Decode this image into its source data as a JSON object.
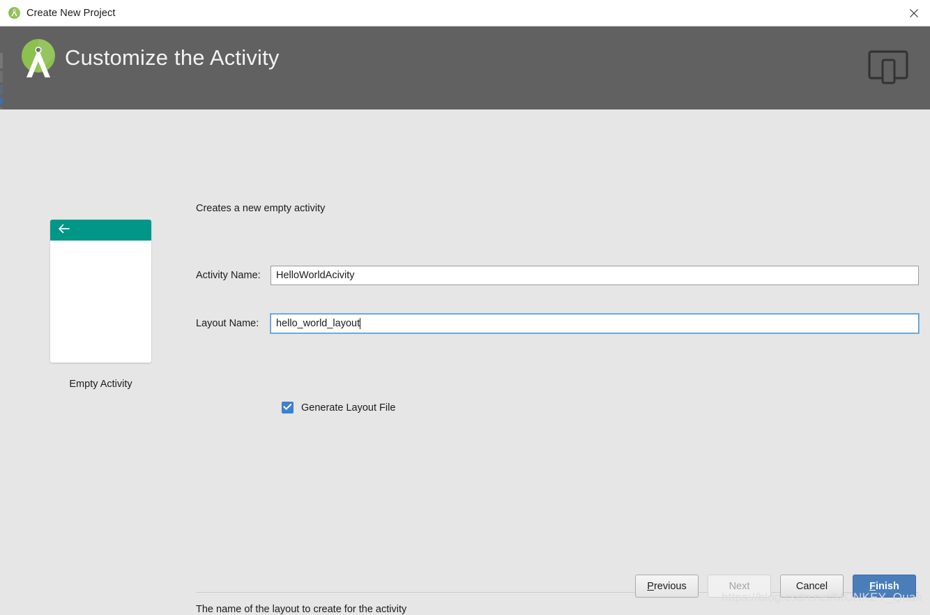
{
  "titlebar": {
    "title": "Create New Project",
    "logo_icon": "android-studio-logo-icon",
    "close_icon": "close-icon"
  },
  "header": {
    "title": "Customize the Activity",
    "logo_icon": "android-studio-compass-logo-icon",
    "device_icon": "devices-tablet-phone-icon",
    "background_color": "#616161"
  },
  "main": {
    "description": "Creates a new empty activity",
    "thumbnail": {
      "label": "Empty Activity",
      "appbar_color": "#009688",
      "back_arrow_icon": "back-arrow-icon"
    },
    "fields": {
      "activity_name": {
        "label": "Activity Name:",
        "value": "HelloWorldAcivity",
        "focused": false
      },
      "layout_name": {
        "label": "Layout Name:",
        "value": "hello_world_layout",
        "focused": true
      }
    },
    "checkbox": {
      "label": "Generate Layout File",
      "checked": true,
      "color": "#3b80d1",
      "check_icon": "checkmark-icon"
    },
    "hint": "The name of the layout to create for the activity"
  },
  "footer": {
    "buttons": [
      {
        "label": "Previous",
        "mnemonic": "P",
        "enabled": true,
        "primary": false
      },
      {
        "label": "Next",
        "mnemonic": "N",
        "enabled": false,
        "primary": false
      },
      {
        "label": "Cancel",
        "mnemonic": "C",
        "enabled": true,
        "primary": false
      },
      {
        "label": "Finish",
        "mnemonic": "F",
        "enabled": true,
        "primary": true
      }
    ],
    "previous_pre": "P",
    "previous_post": "revious",
    "next_label": "Next",
    "cancel_label": "Cancel",
    "finish_pre": "F",
    "finish_post": "inish"
  },
  "watermark": "https://blog.csdn.net/MONKEY_Quan"
}
